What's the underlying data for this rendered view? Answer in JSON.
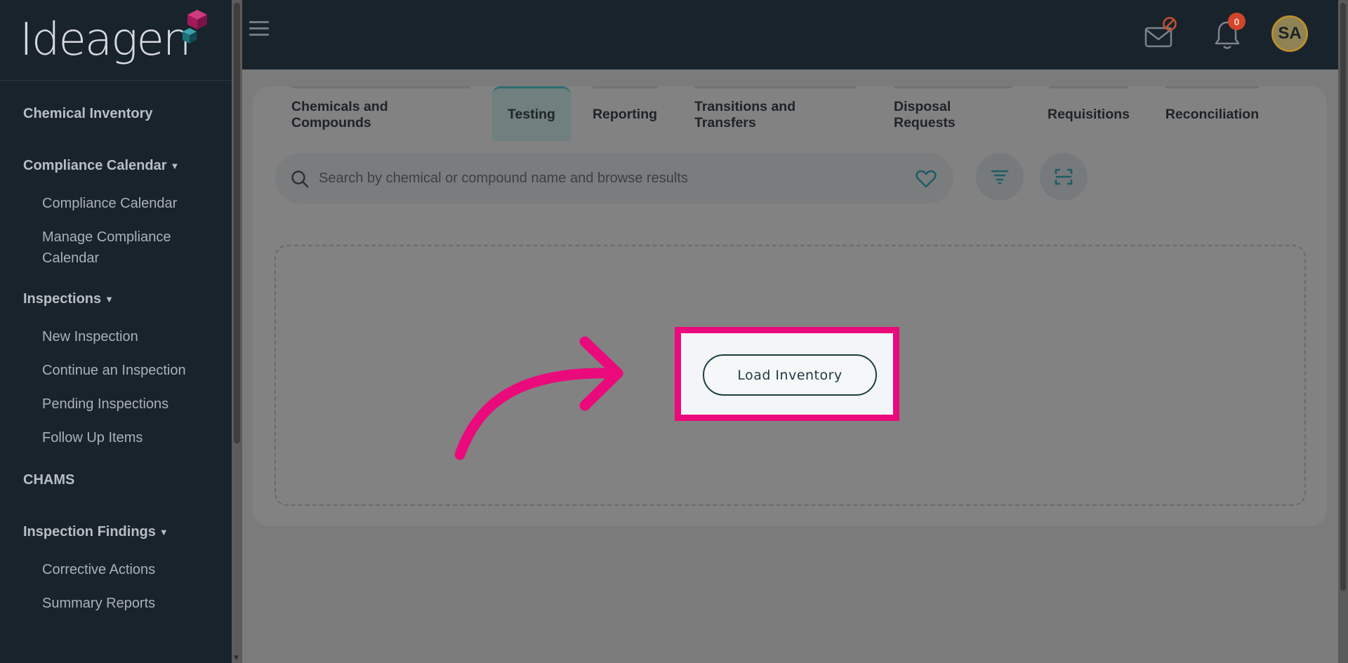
{
  "brand": {
    "logo_text": "Ideagen"
  },
  "sidebar": {
    "items": [
      {
        "type": "section",
        "label": "Chemical Inventory",
        "caret": false
      },
      {
        "type": "section",
        "label": "Compliance Calendar",
        "caret": true
      },
      {
        "type": "sub",
        "label": "Compliance Calendar"
      },
      {
        "type": "sub",
        "label": "Manage Compliance Calendar"
      },
      {
        "type": "section",
        "label": "Inspections",
        "caret": true
      },
      {
        "type": "sub",
        "label": "New Inspection"
      },
      {
        "type": "sub",
        "label": "Continue an Inspection"
      },
      {
        "type": "sub",
        "label": "Pending Inspections"
      },
      {
        "type": "sub",
        "label": "Follow Up Items"
      },
      {
        "type": "section",
        "label": "CHAMS",
        "caret": false
      },
      {
        "type": "section",
        "label": "Inspection Findings",
        "caret": true
      },
      {
        "type": "sub",
        "label": "Corrective Actions"
      },
      {
        "type": "sub",
        "label": "Summary Reports"
      }
    ]
  },
  "topbar": {
    "notification_count": "0",
    "avatar_initials": "SA"
  },
  "tabs": [
    {
      "label": "Chemicals and Compounds",
      "active": false
    },
    {
      "label": "Testing",
      "active": true
    },
    {
      "label": "Reporting",
      "active": false
    },
    {
      "label": "Transitions and Transfers",
      "active": false
    },
    {
      "label": "Disposal Requests",
      "active": false
    },
    {
      "label": "Requisitions",
      "active": false
    },
    {
      "label": "Reconciliation",
      "active": false
    }
  ],
  "search": {
    "placeholder": "Search by chemical or compound name and browse results",
    "value": ""
  },
  "main": {
    "load_button_label": "Load Inventory"
  },
  "colors": {
    "sidebar_bg": "#19232c",
    "highlight": "#ea0a7c",
    "accent_teal": "#2c6e74",
    "badge": "#d1452a"
  }
}
